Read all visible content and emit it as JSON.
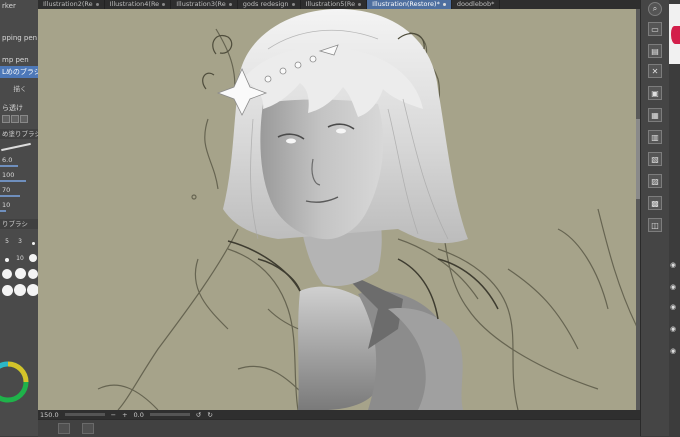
{
  "tabs": [
    {
      "label": "Illustration2(Re"
    },
    {
      "label": "Illustration4(Re"
    },
    {
      "label": "Illustration3(Re"
    },
    {
      "label": "gods redesign"
    },
    {
      "label": "Illustration5(Re"
    },
    {
      "label": "Illustration(Restore)*",
      "active": true
    },
    {
      "label": "doodlebob*"
    }
  ],
  "left_panel": {
    "items": [
      {
        "label": "rker"
      },
      {
        "label": ""
      },
      {
        "label": "pping pen"
      },
      {
        "label": "mp pen"
      },
      {
        "label": "Lめのブラシ",
        "selected": true
      }
    ],
    "header1": "描く",
    "header2": "ら透け",
    "sub_tool_name": "め塗りブラシ",
    "sliders": [
      {
        "label": "6.0"
      },
      {
        "label": "100"
      },
      {
        "label": "70"
      },
      {
        "label": "10"
      }
    ],
    "brush_header": "りブラシ",
    "brush_sizes": [
      "5",
      "3",
      "",
      "",
      "",
      "10",
      "",
      "",
      "",
      "",
      "",
      "",
      "",
      "",
      ""
    ]
  },
  "status": {
    "zoom": "150.0",
    "angle": "0.0"
  }
}
